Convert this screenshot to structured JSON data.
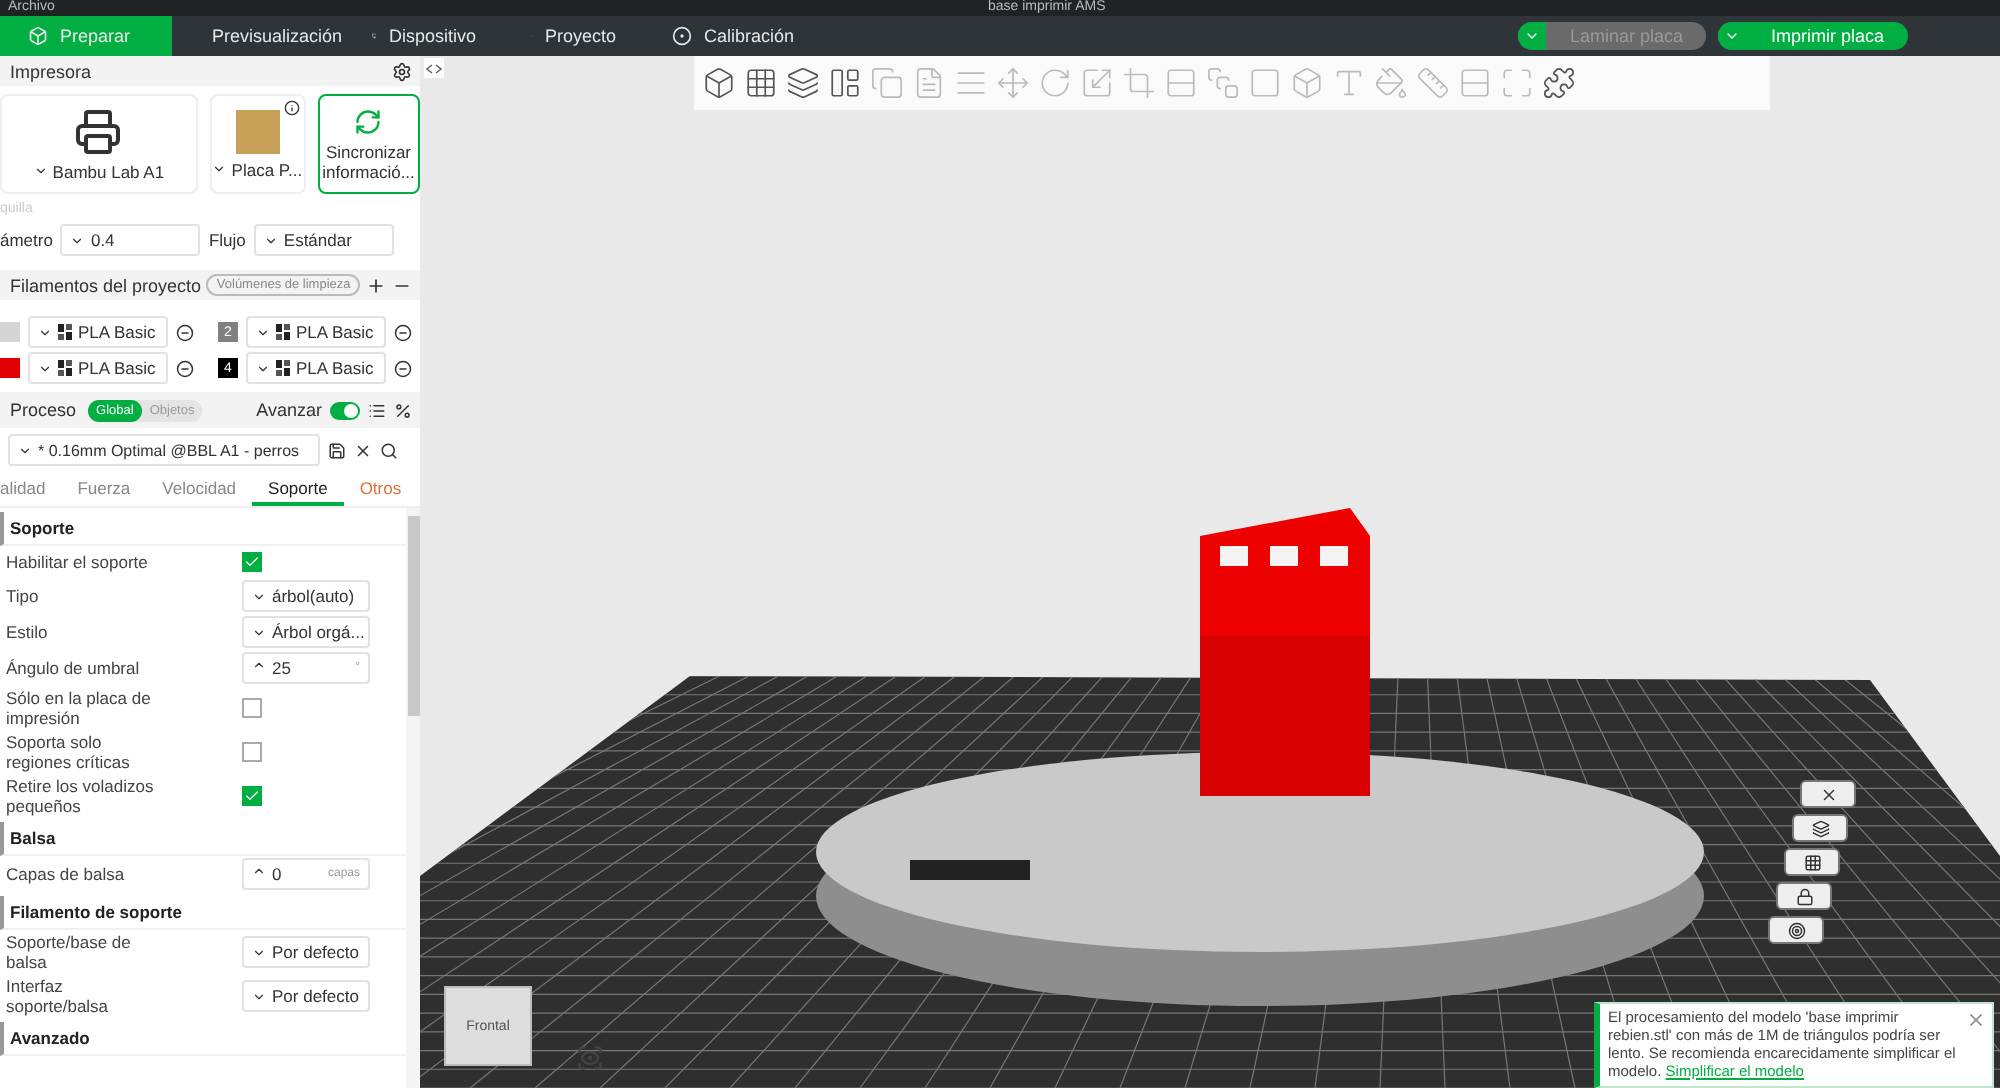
{
  "title_bar": {
    "menu": "Archivo",
    "title": "base imprimir AMS"
  },
  "tabs": [
    {
      "label": "Preparar",
      "selected": true
    },
    {
      "label": "Previsualización",
      "selected": false
    },
    {
      "label": "Dispositivo",
      "selected": false
    },
    {
      "label": "Proyecto",
      "selected": false
    },
    {
      "label": "Calibración",
      "selected": false
    }
  ],
  "actions": [
    {
      "label": "Laminar placa",
      "disabled": true
    },
    {
      "label": "Imprimir placa",
      "disabled": false
    }
  ],
  "printer": {
    "title": "Impresora",
    "name": "Bambu Lab A1",
    "plate": "Placa P...",
    "sync": "Sincronizar informació..."
  },
  "nozzle": {
    "section": "quilla",
    "diameter_label": "ámetro",
    "diameter": "0.4",
    "flow_label": "Flujo",
    "flow": "Estándar"
  },
  "filaments": {
    "title": "Filamentos del proyecto",
    "flush_button": "Volúmenes de limpieza",
    "items": [
      {
        "color": "#d4d4d4",
        "name": "PLA Basic"
      },
      {
        "color": "#808080",
        "number": "2",
        "name": "PLA Basic"
      },
      {
        "color": "#e00000",
        "name": "PLA Basic"
      },
      {
        "color": "#000000",
        "number": "4",
        "name": "PLA Basic"
      }
    ]
  },
  "process": {
    "title": "Proceso",
    "scope": [
      {
        "label": "Global",
        "selected": true
      },
      {
        "label": "Objetos",
        "selected": false
      }
    ],
    "advanced_label": "Avanzar",
    "advanced": true,
    "preset": "* 0.16mm Optimal @BBL A1 - perros"
  },
  "settings_tabs": [
    {
      "label": "alidad",
      "selected": false,
      "modified": false
    },
    {
      "label": "Fuerza",
      "selected": false,
      "modified": false
    },
    {
      "label": "Velocidad",
      "selected": false,
      "modified": false
    },
    {
      "label": "Soporte",
      "selected": true,
      "modified": false
    },
    {
      "label": "Otros",
      "selected": false,
      "modified": true
    }
  ],
  "groups": [
    {
      "title": "Soporte",
      "rows": [
        {
          "label": "Habilitar el soporte",
          "kind": "checkbox",
          "checked": true
        },
        {
          "label": "Tipo",
          "kind": "select",
          "value": "árbol(auto)"
        },
        {
          "label": "Estilo",
          "kind": "select",
          "value": "Árbol orgá..."
        },
        {
          "label": "Ángulo de umbral",
          "kind": "spin",
          "value": "25",
          "unit": "°"
        },
        {
          "label": "Sólo en la placa de impresión",
          "kind": "checkbox",
          "checked": false
        },
        {
          "label": "Soporta solo regiones críticas",
          "kind": "checkbox",
          "checked": false
        },
        {
          "label": "Retire los voladizos pequeños",
          "kind": "checkbox",
          "checked": true
        }
      ]
    },
    {
      "title": "Balsa",
      "rows": [
        {
          "label": "Capas de balsa",
          "kind": "spin",
          "value": "0",
          "unit": "capas"
        }
      ]
    },
    {
      "title": "Filamento de soporte",
      "rows": [
        {
          "label": "Soporte/base de balsa",
          "kind": "select",
          "value": "Por defecto"
        },
        {
          "label": "Interfaz soporte/balsa",
          "kind": "select",
          "value": "Por defecto"
        }
      ]
    },
    {
      "title": "Avanzado"
    }
  ],
  "viewport": {
    "view_cube": "Frontal"
  },
  "notification": {
    "text": "El procesamiento del modelo 'base imprimir rebien.stl' con más de 1M de triángulos podría ser lento. Se recomienda encarecidamente simplificar el modelo.",
    "link": "Simplificar el modelo"
  }
}
